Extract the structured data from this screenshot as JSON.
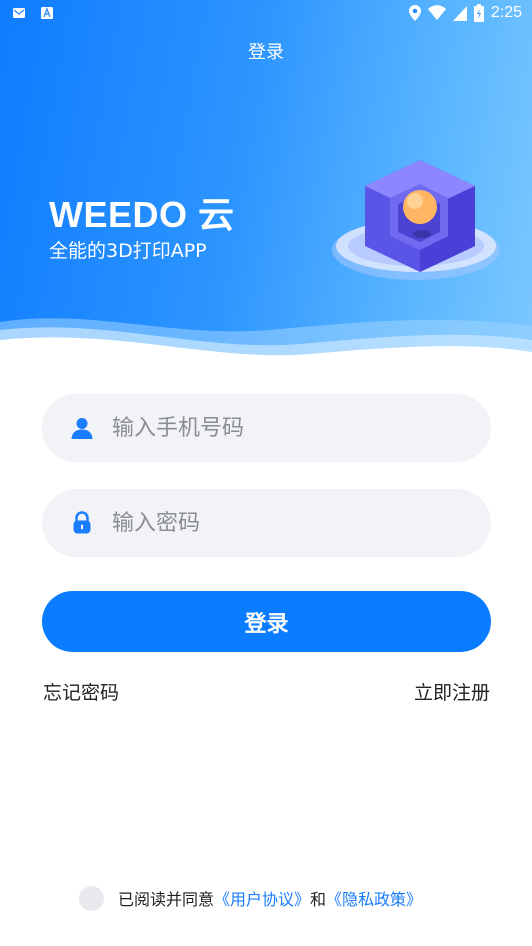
{
  "status_bar": {
    "time": "2:25",
    "left_icons": [
      "mail-icon",
      "a-app-icon"
    ],
    "right_icons": [
      "location-icon",
      "wifi-icon",
      "signal-icon",
      "battery-icon"
    ]
  },
  "nav": {
    "title": "登录"
  },
  "hero": {
    "brand": "WEEDO 云",
    "tagline": "全能的3D打印APP"
  },
  "form": {
    "phone_placeholder": "输入手机号码",
    "password_placeholder": "输入密码",
    "login_label": "登录",
    "forgot_label": "忘记密码",
    "register_label": "立即注册"
  },
  "agreement": {
    "prefix": "已阅读并同意",
    "user_agreement": "《用户协议》",
    "connector": "和",
    "privacy_policy": "《隐私政策》"
  },
  "colors": {
    "primary": "#0a7cff",
    "hero_start": "#0f7cff",
    "hero_end": "#7cc8ff",
    "field_bg": "#f2f3f7",
    "link_blue": "#1a7cff"
  }
}
